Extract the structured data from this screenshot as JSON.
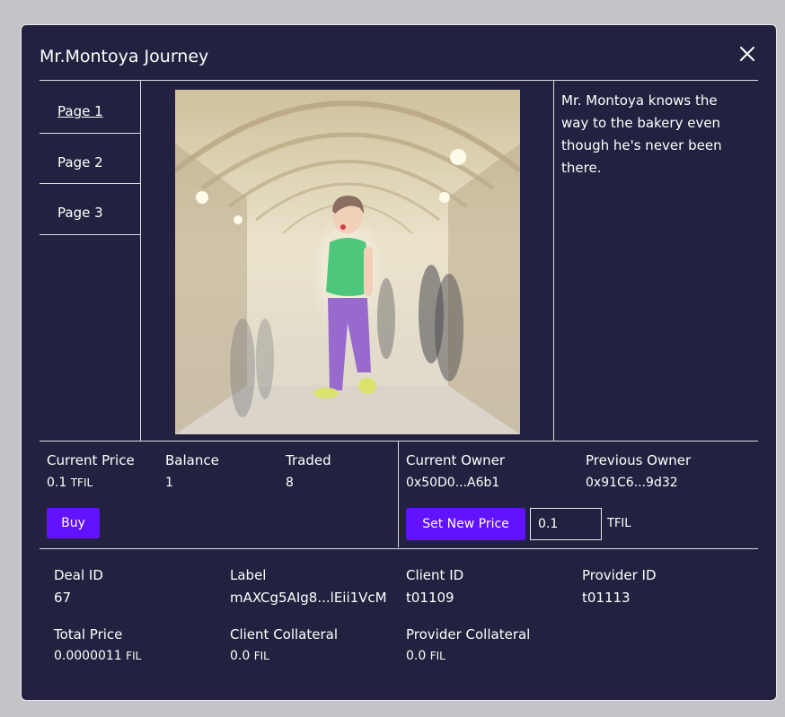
{
  "modal": {
    "title": "Mr.Montoya Journey",
    "close_icon": "close-icon"
  },
  "pages": [
    {
      "label": "Page 1",
      "active": true
    },
    {
      "label": "Page 2",
      "active": false
    },
    {
      "label": "Page 3",
      "active": false
    }
  ],
  "story": {
    "text": "Mr. Montoya knows the way to the bakery even though he's never been there."
  },
  "market": {
    "current_price_label": "Current Price",
    "current_price_value": "0.1",
    "current_price_unit": "TFIL",
    "balance_label": "Balance",
    "balance_value": "1",
    "traded_label": "Traded",
    "traded_value": "8",
    "buy_label": "Buy",
    "current_owner_label": "Current Owner",
    "current_owner_value": "0x50D0...A6b1",
    "previous_owner_label": "Previous Owner",
    "previous_owner_value": "0x91C6...9d32",
    "set_price_label": "Set New Price",
    "new_price_value": "0.1",
    "new_price_unit": "TFIL"
  },
  "deal": {
    "deal_id_label": "Deal ID",
    "deal_id_value": "67",
    "label_label": "Label",
    "label_value": "mAXCg5AIg8...lEii1VcM",
    "client_id_label": "Client ID",
    "client_id_value": "t01109",
    "provider_id_label": "Provider ID",
    "provider_id_value": "t01113",
    "total_price_label": "Total Price",
    "total_price_value": "0.0000011",
    "total_price_unit": "FIL",
    "client_collateral_label": "Client Collateral",
    "client_collateral_value": "0.0",
    "client_collateral_unit": "FIL",
    "provider_collateral_label": "Provider Collateral",
    "provider_collateral_value": "0.0",
    "provider_collateral_unit": "FIL"
  },
  "colors": {
    "modal_bg": "#222240",
    "accent": "#6212ff",
    "backdrop": "#c4c3c8"
  }
}
